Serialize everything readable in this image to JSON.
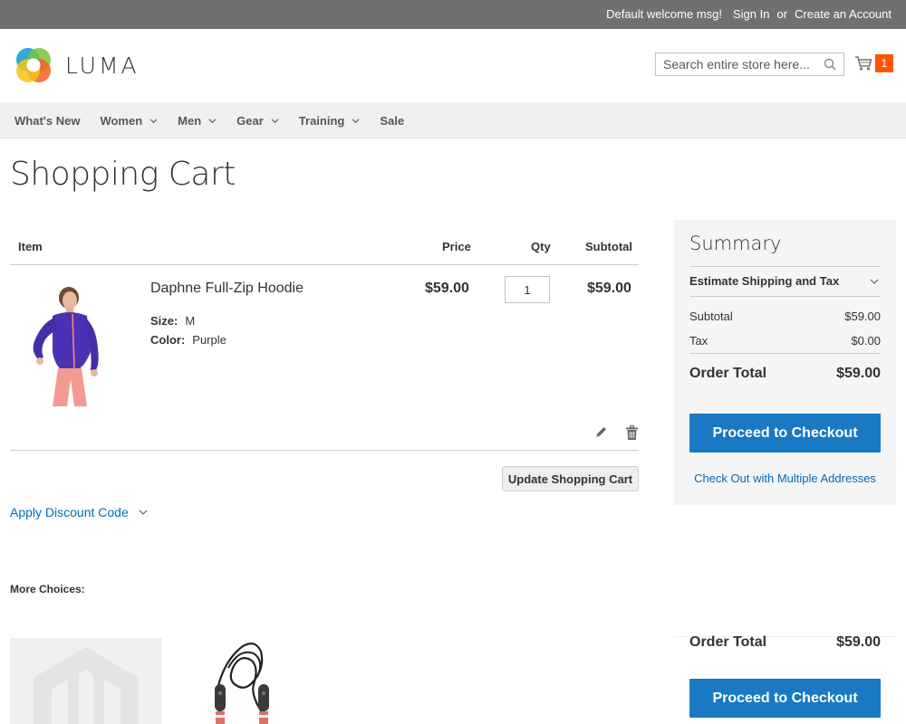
{
  "topbar": {
    "welcome": "Default welcome msg!",
    "sign_in": "Sign In",
    "or": "or",
    "create_account": "Create an Account"
  },
  "header": {
    "logo_text": "LUMA",
    "search_placeholder": "Search entire store here...",
    "cart_count": "1"
  },
  "nav": {
    "items": [
      {
        "label": "What's New",
        "has_dropdown": false
      },
      {
        "label": "Women",
        "has_dropdown": true
      },
      {
        "label": "Men",
        "has_dropdown": true
      },
      {
        "label": "Gear",
        "has_dropdown": true
      },
      {
        "label": "Training",
        "has_dropdown": true
      },
      {
        "label": "Sale",
        "has_dropdown": false
      }
    ]
  },
  "page": {
    "title": "Shopping Cart"
  },
  "cart": {
    "columns": {
      "item": "Item",
      "price": "Price",
      "qty": "Qty",
      "subtotal": "Subtotal"
    },
    "items": [
      {
        "name": "Daphne Full-Zip Hoodie",
        "options": [
          {
            "label": "Size:",
            "value": "M"
          },
          {
            "label": "Color:",
            "value": "Purple"
          }
        ],
        "price": "$59.00",
        "qty": "1",
        "subtotal": "$59.00"
      }
    ],
    "update_button": "Update Shopping Cart",
    "discount_label": "Apply Discount Code"
  },
  "summary": {
    "title": "Summary",
    "estimate_label": "Estimate Shipping and Tax",
    "subtotal_label": "Subtotal",
    "subtotal_value": "$59.00",
    "tax_label": "Tax",
    "tax_value": "$0.00",
    "order_total_label": "Order Total",
    "order_total_value": "$59.00",
    "checkout_button": "Proceed to Checkout",
    "multi_address_link": "Check Out with Multiple Addresses"
  },
  "more_choices": {
    "title": "More Choices:"
  },
  "colors": {
    "topbar": "#6e716e",
    "accent_blue": "#1979c3",
    "link_blue": "#006bb4",
    "cart_badge": "#ff5501"
  }
}
